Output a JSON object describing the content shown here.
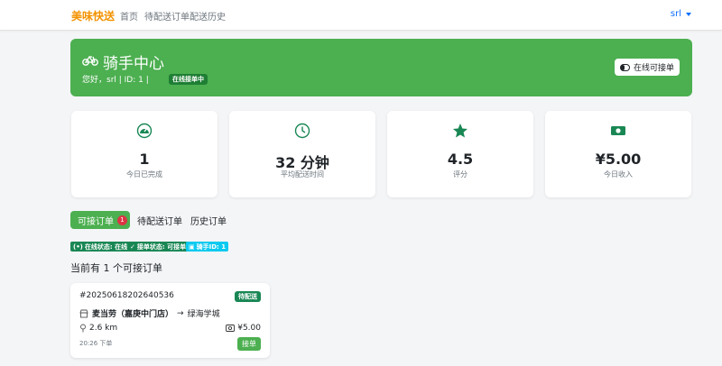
{
  "navbar": {
    "brand": "美味快送",
    "links": [
      "首页",
      "待配送订单",
      "配送历史"
    ],
    "user": "srl"
  },
  "hero": {
    "title": "骑手中心",
    "subtitle": "您好，srl | ID: 1 |",
    "status_badge": "在线接单中",
    "toggle_label": "在线可接单"
  },
  "stats": [
    {
      "icon": "speedometer-icon",
      "value": "1",
      "label": "今日已完成"
    },
    {
      "icon": "clock-icon",
      "value": "32 分钟",
      "label": "平均配送时间"
    },
    {
      "icon": "star-icon",
      "value": "4.5",
      "label": "评分"
    },
    {
      "icon": "cash-icon",
      "value": "¥5.00",
      "label": "今日收入"
    }
  ],
  "tabs": {
    "available": "可接订单",
    "available_count": "1",
    "pending": "待配送订单",
    "history": "历史订单"
  },
  "chips": {
    "online": "在线状态: 在线",
    "accept": "接单状态: 可接单",
    "rider_id": "骑手ID: 1"
  },
  "order_list": {
    "summary": "当前有 1 个可接订单",
    "orders": [
      {
        "id": "#20250618202640536",
        "status": "待配送",
        "shop": "麦当劳（嘉庚中门店）",
        "arrow": "→",
        "destination": "绿海学城",
        "distance": "2.6 km",
        "fee": "¥5.00",
        "time": "20:26 下单",
        "accept_label": "接单"
      }
    ]
  },
  "colors": {
    "brand": "#f39200",
    "hero_green": "#4caf50",
    "status_green": "#198754",
    "info_cyan": "#0dcaf0",
    "danger": "#dc3545"
  }
}
